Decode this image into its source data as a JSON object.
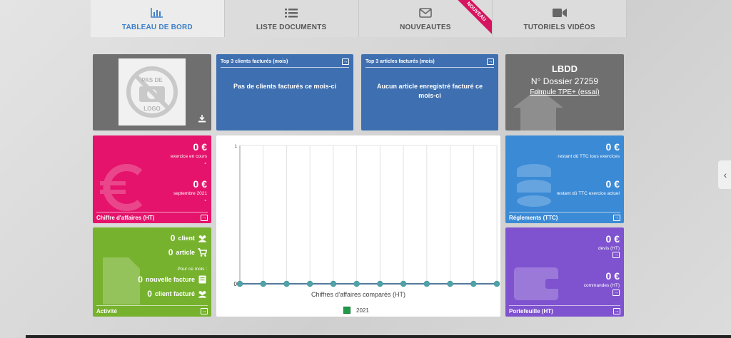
{
  "tabs": [
    {
      "label": "TABLEAU DE BORD",
      "icon": "bar-chart-icon",
      "active": true
    },
    {
      "label": "LISTE DOCUMENTS",
      "icon": "list-icon",
      "active": false
    },
    {
      "label": "NOUVEAUTES",
      "icon": "envelope-icon",
      "active": false,
      "ribbon": "NOUVEAU"
    },
    {
      "label": "TUTORIELS VIDÉOS",
      "icon": "video-camera-icon",
      "active": false
    }
  ],
  "logo_tile": {
    "logo_text_top": "PAS DE",
    "logo_text_bottom": "LOGO",
    "icon": "download-icon"
  },
  "top_clients": {
    "title": "Top 3 clients facturés (mois)",
    "message": "Pas de clients facturés ce mois-ci"
  },
  "top_articles": {
    "title": "Top 3 articles facturés (mois)",
    "message": "Aucun article enregistré facturé ce mois-ci"
  },
  "company": {
    "name": "LBDD",
    "dossier": "N° Dossier 27259",
    "plan": "Formule TPE+ (essai)"
  },
  "revenue": {
    "value1": "0 €",
    "label1": "exercice en cours",
    "dash1": "-",
    "value2": "0 €",
    "label2": "septembre 2021",
    "dash2": "-",
    "footer": "Chiffre d'affaires (HT)"
  },
  "activity": {
    "clients_count": "0",
    "clients_label": "client",
    "articles_count": "0",
    "articles_label": "article",
    "period_label": "Pour ce mois :",
    "invoices_count": "0",
    "invoices_label": "nouvelle facture",
    "billed_count": "0",
    "billed_label": "client facturé",
    "footer": "Activité"
  },
  "payments": {
    "value1": "0 €",
    "label1": "restant dû TTC tous exercices",
    "value2": "0 €",
    "label2": "restant dû TTC exercice actuel",
    "footer": "Réglements (TTC)"
  },
  "portfolio": {
    "value1": "0 €",
    "label1": "devis (HT)",
    "value2": "0 €",
    "label2": "commandes (HT)",
    "footer": "Portefeuille (HT)"
  },
  "chart_data": {
    "type": "line",
    "title": "Chiffres d'affaires comparés (HT)",
    "ylim": [
      0,
      1
    ],
    "yticks": [
      "0",
      "1"
    ],
    "grid": true,
    "legend_position": "bottom",
    "series": [
      {
        "name": "2021",
        "color": "#1e9b4a",
        "values": [
          0,
          0,
          0,
          0,
          0,
          0,
          0,
          0,
          0,
          0,
          0,
          0
        ]
      }
    ],
    "marker_color": "#4fa3a8",
    "line_color": "#1c4f7c"
  },
  "colors": {
    "accent": "#3c7fc9",
    "pink": "#e5136b",
    "green": "#76b22d",
    "blue": "#3e6fb0",
    "teal": "#3a8ad6",
    "purple": "#7f53cf",
    "grey": "#6f6f6f"
  }
}
